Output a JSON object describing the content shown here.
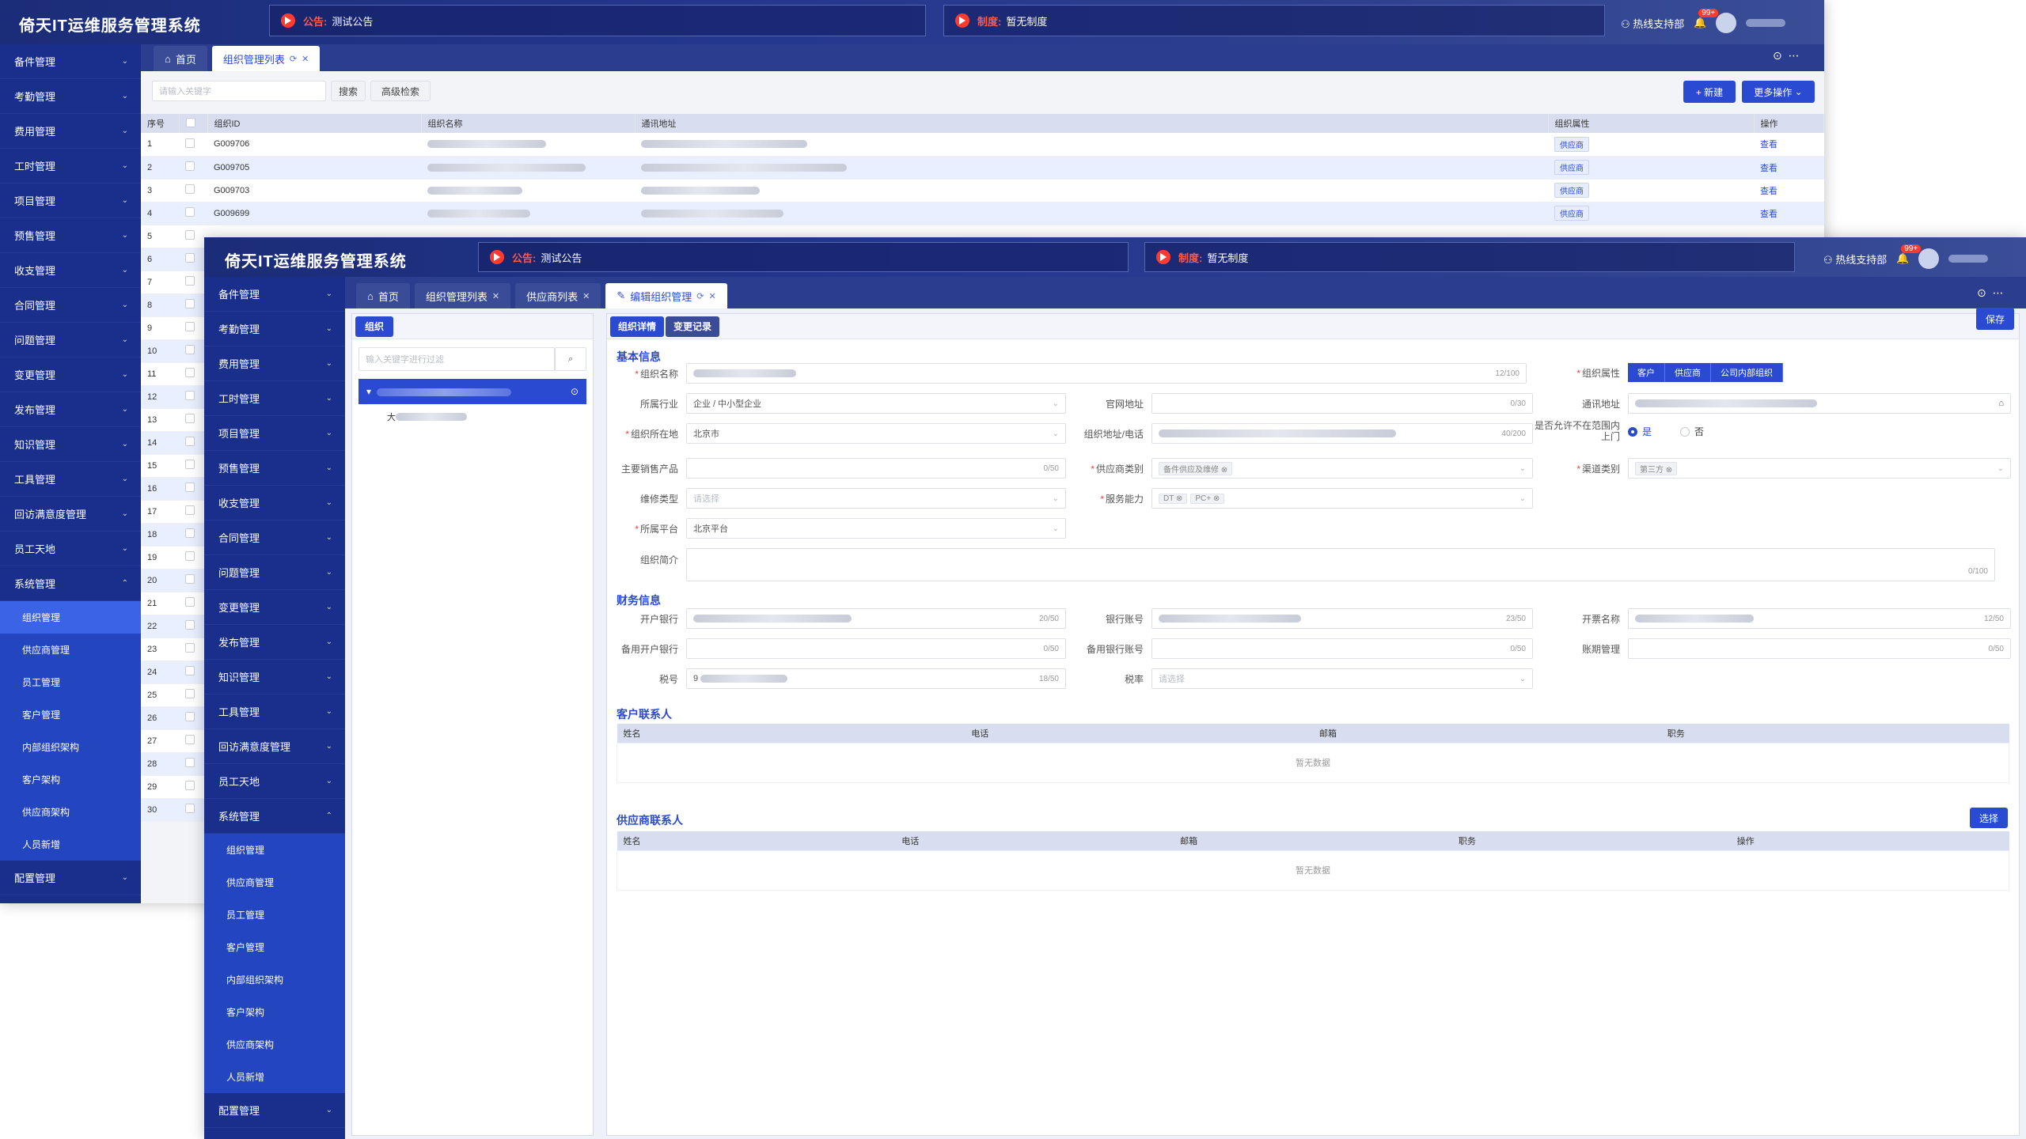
{
  "app_title": "倚天IT运维服务管理系统",
  "notice": {
    "label": "公告:",
    "text": "测试公告"
  },
  "policy": {
    "label": "制度:",
    "text": "暂无制度"
  },
  "header_right": {
    "hotline": "热线支持部",
    "badge": "99+"
  },
  "sidebar_back": {
    "items": [
      "备件管理",
      "考勤管理",
      "费用管理",
      "工时管理",
      "项目管理",
      "预售管理",
      "收支管理",
      "合同管理",
      "问题管理",
      "变更管理",
      "发布管理",
      "知识管理",
      "工具管理",
      "回访满意度管理",
      "员工天地",
      "系统管理"
    ],
    "sub_items": [
      "组织管理",
      "供应商管理",
      "员工管理",
      "客户管理",
      "内部组织架构",
      "客户架构",
      "供应商架构",
      "人员新增"
    ],
    "footer_item": "配置管理"
  },
  "back_window": {
    "tabs": {
      "home": "首页",
      "active": "组织管理列表"
    },
    "search": {
      "placeholder": "请输入关键字",
      "search_btn": "搜索",
      "advanced_btn": "高级检索"
    },
    "actions": {
      "new_btn": "+ 新建",
      "more_btn": "更多操作"
    },
    "columns": {
      "no": "序号",
      "id": "组织ID",
      "name": "组织名称",
      "address": "通讯地址",
      "attr": "组织属性",
      "op": "操作"
    },
    "rows": [
      {
        "no": "1",
        "id": "G009706",
        "attr": "供应商",
        "op": "查看"
      },
      {
        "no": "2",
        "id": "G009705",
        "attr": "供应商",
        "op": "查看"
      },
      {
        "no": "3",
        "id": "G009703",
        "attr": "供应商",
        "op": "查看"
      },
      {
        "no": "4",
        "id": "G009699",
        "attr": "供应商",
        "op": "查看"
      }
    ],
    "row_numbers": [
      "5",
      "6",
      "7",
      "8",
      "9",
      "10",
      "11",
      "12",
      "13",
      "14",
      "15",
      "16",
      "17",
      "18",
      "19",
      "20",
      "21",
      "22",
      "23",
      "24",
      "25",
      "26",
      "27",
      "28",
      "29",
      "30"
    ]
  },
  "front_window": {
    "tabs": {
      "home": "首页",
      "list": "组织管理列表",
      "supplier": "供应商列表",
      "edit": "编辑组织管理"
    },
    "left_panel": {
      "title": "组织",
      "search_placeholder": "输入关键字进行过滤",
      "tree_child_prefix": "大"
    },
    "right_tabs": {
      "detail": "组织详情",
      "changes": "变更记录"
    },
    "save_btn": "保存",
    "basic": {
      "title": "基本信息",
      "org_name": {
        "label": "组织名称",
        "count": "12/100"
      },
      "org_attr": {
        "label": "组织属性",
        "options": [
          "客户",
          "供应商",
          "公司内部组织"
        ]
      },
      "industry": {
        "label": "所属行业",
        "value": "企业 / 中小型企业"
      },
      "website": {
        "label": "官网地址",
        "count": "0/30"
      },
      "address": {
        "label": "通讯地址"
      },
      "location": {
        "label": "组织所在地",
        "value": "北京市"
      },
      "addr_phone": {
        "label": "组织地址/电话",
        "count": "40/200"
      },
      "range": {
        "label": "是否允许不在范围内上门",
        "yes": "是",
        "no": "否"
      },
      "main_products": {
        "label": "主要销售产品",
        "count": "0/50"
      },
      "supplier_type": {
        "label": "供应商类别",
        "chip": "备件供应及维修"
      },
      "channel_type": {
        "label": "渠道类别",
        "chip": "第三方"
      },
      "repair_type": {
        "label": "维修类型",
        "placeholder": "请选择"
      },
      "service_ability": {
        "label": "服务能力",
        "chips": [
          "DT",
          "PC+"
        ]
      },
      "platform": {
        "label": "所属平台",
        "value": "北京平台"
      },
      "intro": {
        "label": "组织简介",
        "count": "0/100"
      }
    },
    "finance": {
      "title": "财务信息",
      "bank": {
        "label": "开户银行",
        "count": "20/50"
      },
      "account": {
        "label": "银行账号",
        "count": "23/50"
      },
      "invoice_name": {
        "label": "开票名称",
        "count": "12/50"
      },
      "backup_bank": {
        "label": "备用开户银行",
        "count": "0/50"
      },
      "backup_account": {
        "label": "备用银行账号",
        "count": "0/50"
      },
      "period": {
        "label": "账期管理",
        "count": "0/50"
      },
      "tax_no": {
        "label": "税号",
        "prefix": "9",
        "count": "18/50"
      },
      "tax_rate": {
        "label": "税率",
        "placeholder": "请选择"
      }
    },
    "customer_contacts": {
      "title": "客户联系人",
      "cols": [
        "姓名",
        "电话",
        "邮箱",
        "职务"
      ],
      "empty": "暂无数据"
    },
    "supplier_contacts": {
      "title": "供应商联系人",
      "select_btn": "选择",
      "cols": [
        "姓名",
        "电话",
        "邮箱",
        "职务",
        "操作"
      ],
      "empty": "暂无数据"
    }
  }
}
